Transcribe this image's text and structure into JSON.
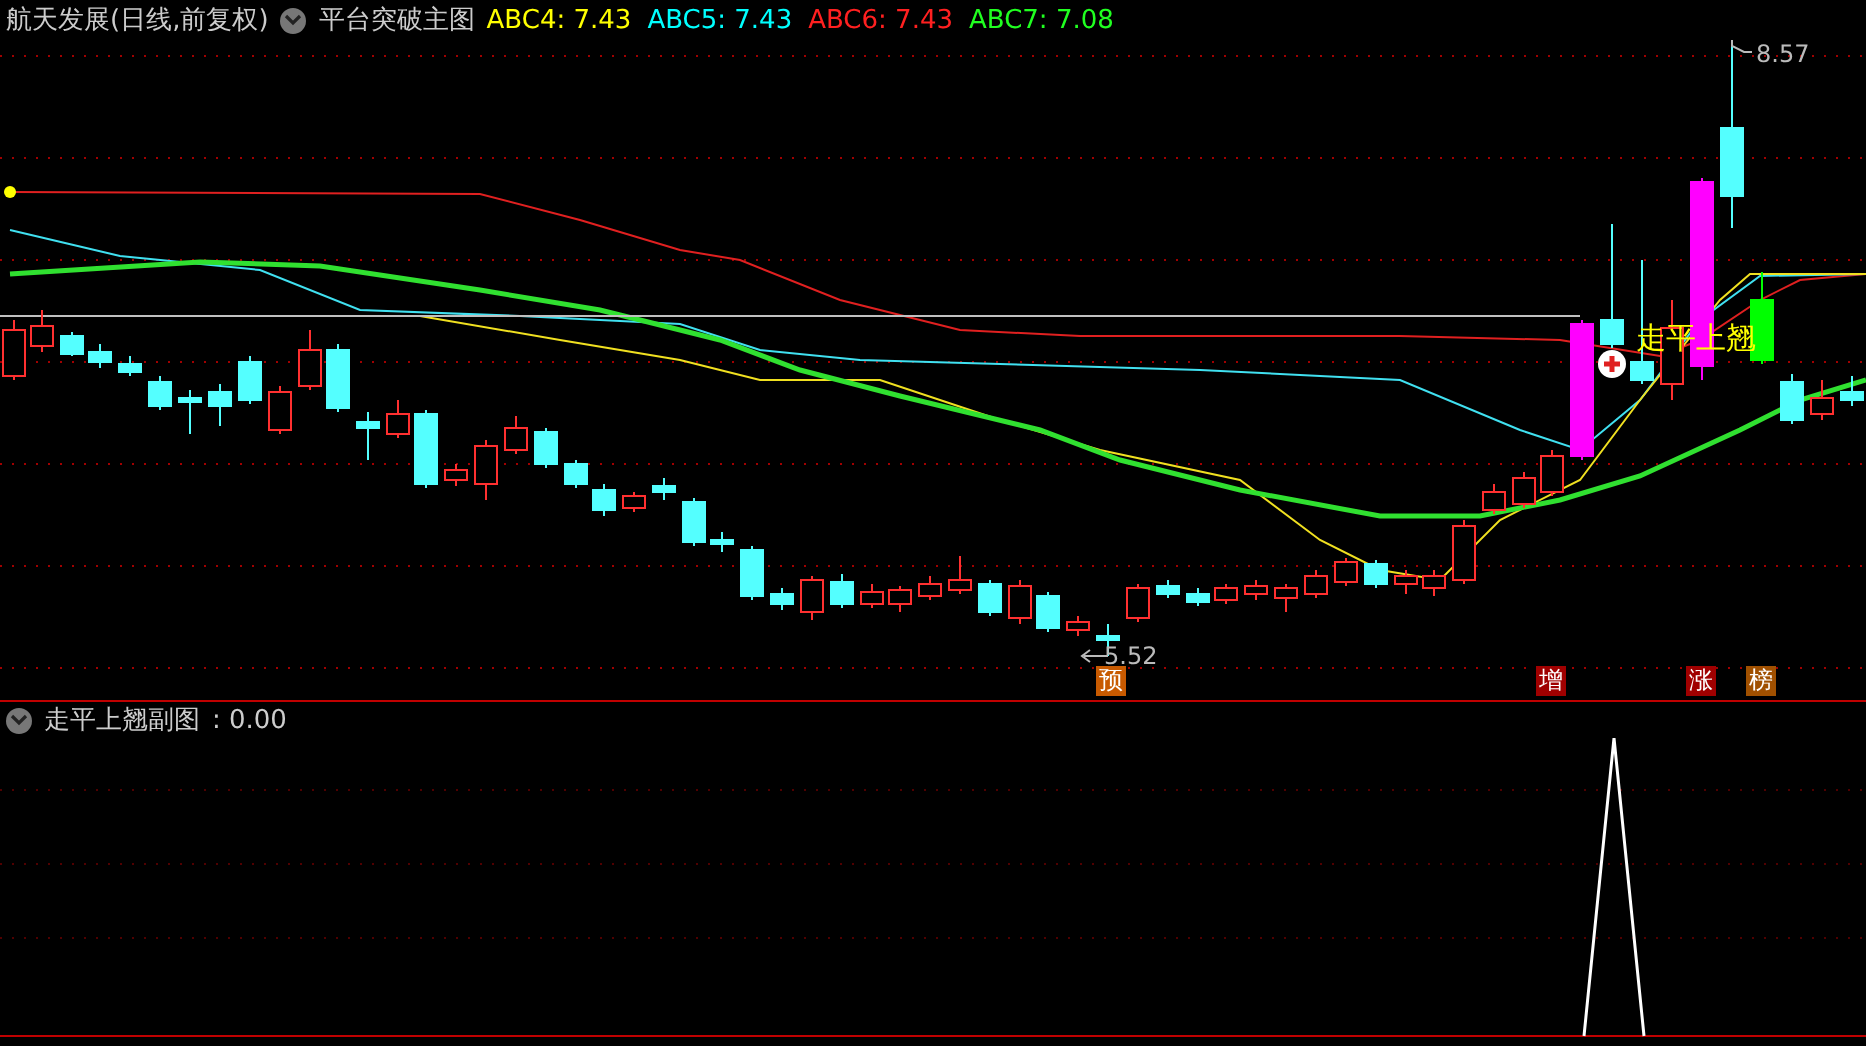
{
  "header": {
    "title": "航天发展(日线,前复权)",
    "indicator": "平台突破主图",
    "legend": [
      {
        "label": "ABC4:",
        "value": "7.43",
        "color": "#ffff00"
      },
      {
        "label": "ABC5:",
        "value": "7.43",
        "color": "#00ffff"
      },
      {
        "label": "ABC6:",
        "value": "7.43",
        "color": "#ff2020"
      },
      {
        "label": "ABC7:",
        "value": "7.08",
        "color": "#20ff20"
      }
    ]
  },
  "main_chart": {
    "high_label": "8.57",
    "low_label": "5.52",
    "signal_text": "走平上翘",
    "markers": [
      {
        "text": "预",
        "color": "#c85a00"
      },
      {
        "text": "增",
        "color": "#a00000"
      },
      {
        "text": "涨",
        "color": "#a00000"
      },
      {
        "text": "榜",
        "color": "#a05000"
      }
    ]
  },
  "sub_panel": {
    "title": "走平上翘副图",
    "value": ": 0.00"
  }
}
